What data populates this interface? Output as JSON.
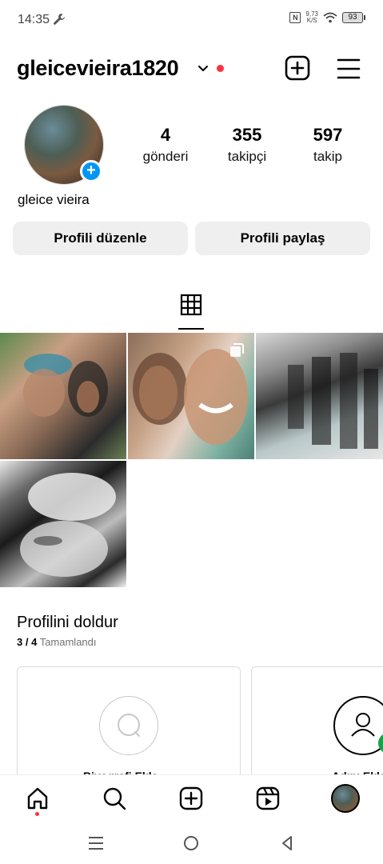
{
  "status_bar": {
    "time": "14:35",
    "net_speed_value": "9,73",
    "net_speed_unit": "K/S",
    "nfc_label": "N",
    "battery": "93",
    "icons": [
      "wrench-icon",
      "nfc-icon",
      "wifi-icon",
      "battery-icon"
    ]
  },
  "header": {
    "username": "gleicevieira1820",
    "icons": [
      "chevron-down-icon",
      "new-post-icon",
      "menu-icon"
    ],
    "notification_color": "#ff3040"
  },
  "profile": {
    "full_name": "gleice vieira",
    "stats": [
      {
        "value": "4",
        "label": "gönderi"
      },
      {
        "value": "355",
        "label": "takipçi"
      },
      {
        "value": "597",
        "label": "takip"
      }
    ],
    "add_story_symbol": "+",
    "accent": "#0095f6"
  },
  "actions": {
    "edit_label": "Profili düzenle",
    "share_label": "Profili paylaş"
  },
  "tabs": {
    "active": "grid-icon"
  },
  "grid": {
    "posts": [
      {
        "kind": "photo",
        "multi": false
      },
      {
        "kind": "photo",
        "multi": true
      },
      {
        "kind": "photo",
        "multi": false
      },
      {
        "kind": "photo",
        "multi": false
      }
    ]
  },
  "complete_profile": {
    "title": "Profilini doldur",
    "progress_count": "3 / 4",
    "progress_label": "Tamamlandı",
    "cards": [
      {
        "icon": "chat-bubble-icon",
        "label": "Biyografi Ekle"
      },
      {
        "icon": "user-icon",
        "label": "Adını Ekle"
      }
    ]
  },
  "bottom_nav": {
    "items": [
      "home-icon",
      "search-icon",
      "create-icon",
      "reels-icon",
      "profile-avatar"
    ]
  },
  "system_nav": {
    "items": [
      "recents-icon",
      "home-circle-icon",
      "back-icon"
    ]
  }
}
